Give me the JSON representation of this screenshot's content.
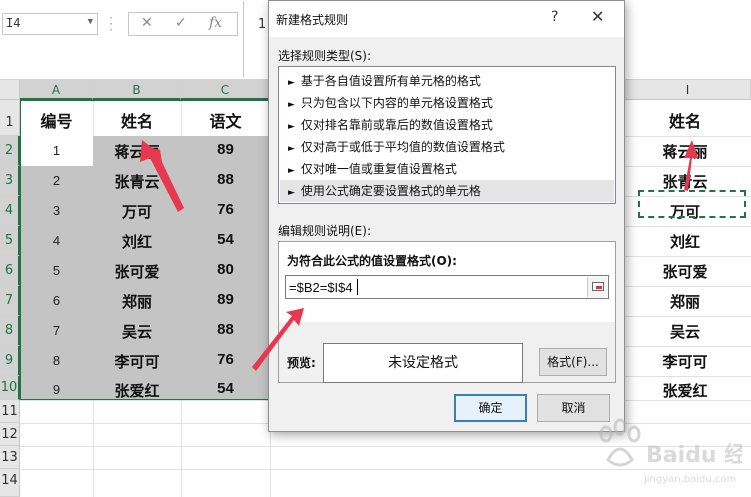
{
  "formula_bar": {
    "name_box": "I4",
    "cancel_glyph": "✕",
    "enter_glyph": "✓",
    "fx_glyph": "fx",
    "content": "1"
  },
  "columns": [
    {
      "name": "A",
      "selected": true
    },
    {
      "name": "B",
      "selected": true
    },
    {
      "name": "C",
      "selected": true
    },
    {
      "name": "I",
      "selected": false
    }
  ],
  "rows": [
    "1",
    "2",
    "3",
    "4",
    "5",
    "6",
    "7",
    "8",
    "9",
    "10",
    "11",
    "12",
    "13",
    "14"
  ],
  "table": {
    "headers": [
      "编号",
      "姓名",
      "语文"
    ],
    "rows": [
      [
        "1",
        "蒋云丽",
        "89"
      ],
      [
        "2",
        "张青云",
        "88"
      ],
      [
        "3",
        "万可",
        "76"
      ],
      [
        "4",
        "刘红",
        "54"
      ],
      [
        "5",
        "张可爱",
        "80"
      ],
      [
        "6",
        "郑丽",
        "89"
      ],
      [
        "7",
        "吴云",
        "88"
      ],
      [
        "8",
        "李可可",
        "76"
      ],
      [
        "9",
        "张爱红",
        "54"
      ]
    ]
  },
  "column_i": {
    "header": "姓名",
    "values": [
      "蒋云丽",
      "张青云",
      "万可",
      "刘红",
      "张可爱",
      "郑丽",
      "吴云",
      "李可可",
      "张爱红"
    ]
  },
  "dialog": {
    "title": "新建格式规则",
    "help": "?",
    "close": "✕",
    "select_type_label": "选择规则类型(S):",
    "rule_types": [
      "基于各自值设置所有单元格的格式",
      "只为包含以下内容的单元格设置格式",
      "仅对排名靠前或靠后的数值设置格式",
      "仅对高于或低于平均值的数值设置格式",
      "仅对唯一值或重复值设置格式",
      "使用公式确定要设置格式的单元格"
    ],
    "edit_desc_label": "编辑规则说明(E):",
    "formula_label": "为符合此公式的值设置格式(O):",
    "formula_value": "=$B2=$I$4",
    "preview_label": "预览:",
    "preview_text": "未设定格式",
    "format_button": "格式(F)...",
    "ok_button": "确定",
    "cancel_button": "取消"
  },
  "watermark": {
    "brand": "Baidu 经验",
    "url": "jingyan.baidu.com"
  },
  "colors": {
    "accent_green": "#217346",
    "arrow_red": "#e8384f",
    "selection_gray": "#c4c4c4"
  }
}
